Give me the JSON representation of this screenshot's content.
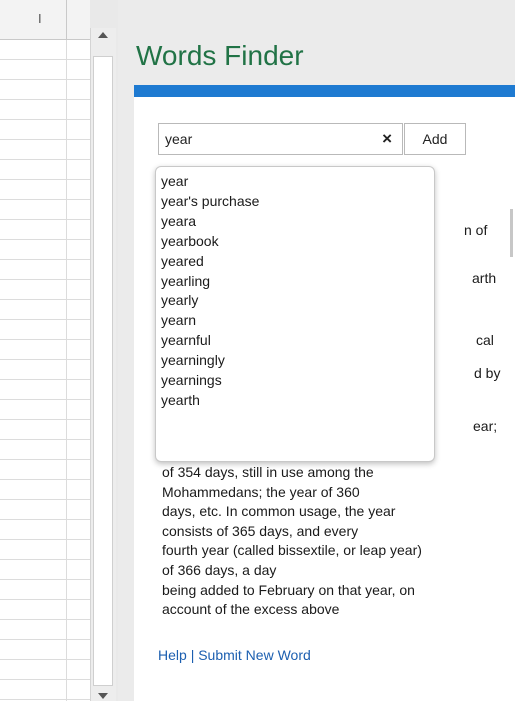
{
  "spreadsheet": {
    "column_header": "I"
  },
  "pane": {
    "title": "Words Finder",
    "accent_color": "#217346",
    "bar_color": "#1e7ad1"
  },
  "search": {
    "value": "year",
    "clear_symbol": "×",
    "add_label": "Add"
  },
  "suggestions": [
    "year",
    "year's purchase",
    "yeara",
    "yearbook",
    "yeared",
    "yearling",
    "yearly",
    "yearn",
    "yearnful",
    "yearningly",
    "yearnings",
    "yearth"
  ],
  "definition": {
    "hidden_fragments": [
      "n of",
      "arth",
      "cal",
      "d by",
      "ear;"
    ],
    "lines": [
      "of 354 days, still in use among the",
      "Mohammedans; the year of 360",
      "days, etc. In common usage, the year",
      "consists of 365 days, and every",
      "fourth year (called bissextile, or leap year)",
      "of 366 days, a day",
      "being added to February on that year, on",
      "account of the excess above"
    ]
  },
  "footer": {
    "help": "Help",
    "separator": "|",
    "submit": "Submit New Word"
  }
}
